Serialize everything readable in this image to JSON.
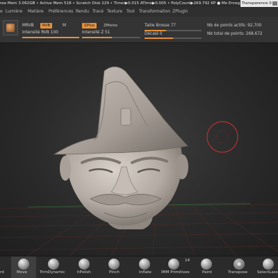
{
  "status_bar": {
    "text": "ree Mem 3.062GB • Active Mem 518 • Scratch Disk 229 • Timer▶0.015 ATime▶0.005 • PolyCount▶269.792 KP ● Me Enreg. Rapide",
    "transparency_label": "Transparence 0"
  },
  "menu": {
    "items": [
      "e",
      "Lumière",
      "Matière",
      "Préférences",
      "Rendu",
      "Tracé",
      "Texture",
      "Tool",
      "Transformation",
      "ZPlugin"
    ]
  },
  "tool_shelf": {
    "mrgb_label": "MRVB",
    "rgb_label": "RVB",
    "m_label": "M",
    "zadd_label": "ZPlus",
    "zsub_label": "ZMoins",
    "rgb_intensity_label": "Intensité RVB 100",
    "z_intensity_label": "Intensité Z 51",
    "draw_size_label": "Taille Brosse 77",
    "focal_shift_label": "Décalé 0",
    "active_points_label": "Nb de points actifs: 92,700",
    "total_points_label": "Nb total de points: 268,672",
    "rgb_intensity_fraction": 1.0,
    "z_intensity_fraction": 0.51,
    "draw_size_fraction": 0.38,
    "focal_shift_fraction": 0.5
  },
  "brushes": {
    "items": [
      {
        "name": "rd",
        "active": false
      },
      {
        "name": "Move",
        "active": true
      },
      {
        "name": "TrimDynamic",
        "active": false
      },
      {
        "name": "hPolish",
        "active": false
      },
      {
        "name": "Pinch",
        "active": false
      },
      {
        "name": "Inflate",
        "active": false
      },
      {
        "name": "IMM Primitives",
        "active": false
      },
      {
        "name": "Paint",
        "active": false
      },
      {
        "name": "Transpose",
        "active": false
      },
      {
        "name": "SelectLasso",
        "active": false
      }
    ],
    "imm_count": "14"
  },
  "colors": {
    "accent": "#e8913a",
    "cursor_ring": "#b5302e",
    "sculpt": "#bdb5ae"
  }
}
